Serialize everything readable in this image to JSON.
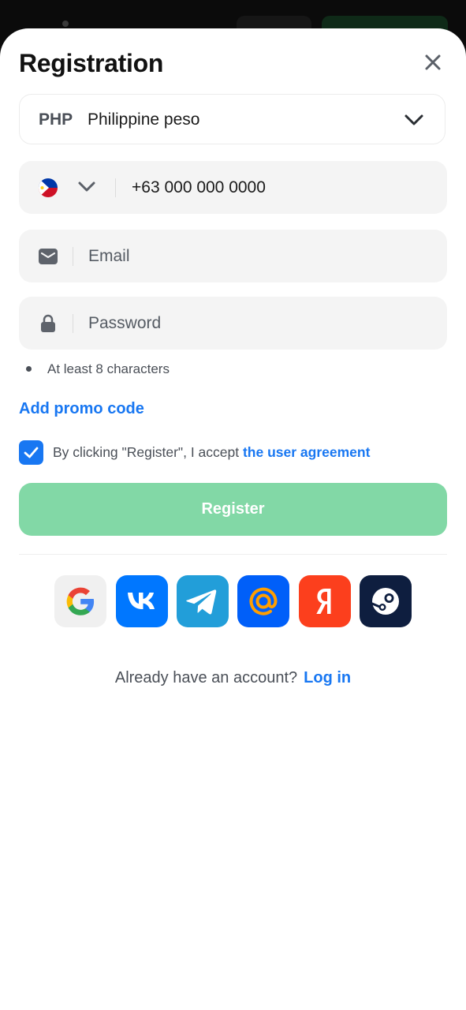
{
  "sheet": {
    "title": "Registration"
  },
  "currency": {
    "code": "PHP",
    "name": "Philippine peso"
  },
  "phone": {
    "placeholder": "+63 000 000 0000"
  },
  "email": {
    "placeholder": "Email"
  },
  "password": {
    "placeholder": "Password",
    "hint": "At least 8 characters"
  },
  "promo": {
    "label": "Add promo code"
  },
  "agreement": {
    "checked": true,
    "text": "By clicking \"Register\", I accept ",
    "link": "the user agreement"
  },
  "register": {
    "label": "Register"
  },
  "social": [
    {
      "name": "google",
      "icon": "google-icon",
      "color": "#f0f0f0"
    },
    {
      "name": "vk",
      "icon": "vk-icon",
      "color": "#0077ff"
    },
    {
      "name": "telegram",
      "icon": "telegram-icon",
      "color": "#229ed9"
    },
    {
      "name": "mail-ru",
      "icon": "at-sign-icon",
      "color": "#005ff9"
    },
    {
      "name": "yandex",
      "icon": "yandex-icon",
      "color": "#fc3f1d"
    },
    {
      "name": "steam",
      "icon": "steam-icon",
      "color": "#0e1e3f"
    }
  ],
  "footer": {
    "question": "Already have an account?",
    "login": "Log in"
  },
  "colors": {
    "accent": "#1877f2",
    "register_button": "#82d8a6"
  }
}
